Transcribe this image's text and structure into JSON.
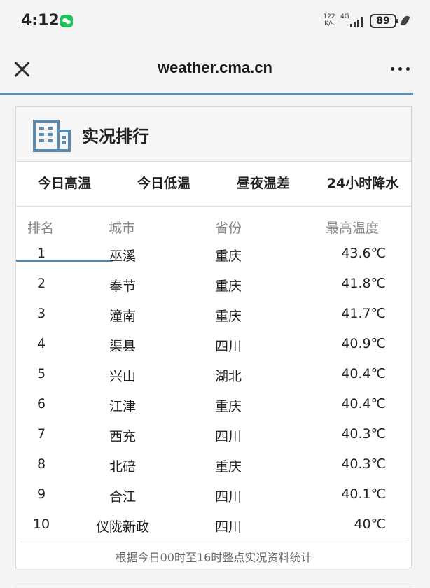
{
  "status_bar": {
    "time": "4:12",
    "net_speed_value": "122",
    "net_speed_unit": "K/s",
    "network_type": "4G",
    "battery": "89"
  },
  "toolbar": {
    "title": "weather.cma.cn"
  },
  "card": {
    "title": "实况排行",
    "tabs": [
      {
        "label": "今日高温",
        "active": true
      },
      {
        "label": "今日低温",
        "active": false
      },
      {
        "label": "昼夜温差",
        "active": false
      },
      {
        "label": "24小时降水",
        "active": false
      }
    ],
    "columns": {
      "rank": "排名",
      "city": "城市",
      "province": "省份",
      "temp": "最高温度"
    },
    "rows": [
      {
        "rank": "1",
        "city": "巫溪",
        "province": "重庆",
        "temp": "43.6℃"
      },
      {
        "rank": "2",
        "city": "奉节",
        "province": "重庆",
        "temp": "41.8℃"
      },
      {
        "rank": "3",
        "city": "潼南",
        "province": "重庆",
        "temp": "41.7℃"
      },
      {
        "rank": "4",
        "city": "渠县",
        "province": "四川",
        "temp": "40.9℃"
      },
      {
        "rank": "5",
        "city": "兴山",
        "province": "湖北",
        "temp": "40.4℃"
      },
      {
        "rank": "6",
        "city": "江津",
        "province": "重庆",
        "temp": "40.4℃"
      },
      {
        "rank": "7",
        "city": "西充",
        "province": "四川",
        "temp": "40.3℃"
      },
      {
        "rank": "8",
        "city": "北碚",
        "province": "重庆",
        "temp": "40.3℃"
      },
      {
        "rank": "9",
        "city": "合江",
        "province": "四川",
        "temp": "40.1℃"
      },
      {
        "rank": "10",
        "city": "仪陇新政",
        "province": "四川",
        "temp": "40℃"
      }
    ],
    "footer": "根据今日00时至16时整点实况资料统计"
  },
  "colors": {
    "accent": "#5b8ab0",
    "wechat": "#1fc15c"
  },
  "icons": {
    "close": "close-icon",
    "more": "more-icon",
    "building": "building-icon"
  }
}
